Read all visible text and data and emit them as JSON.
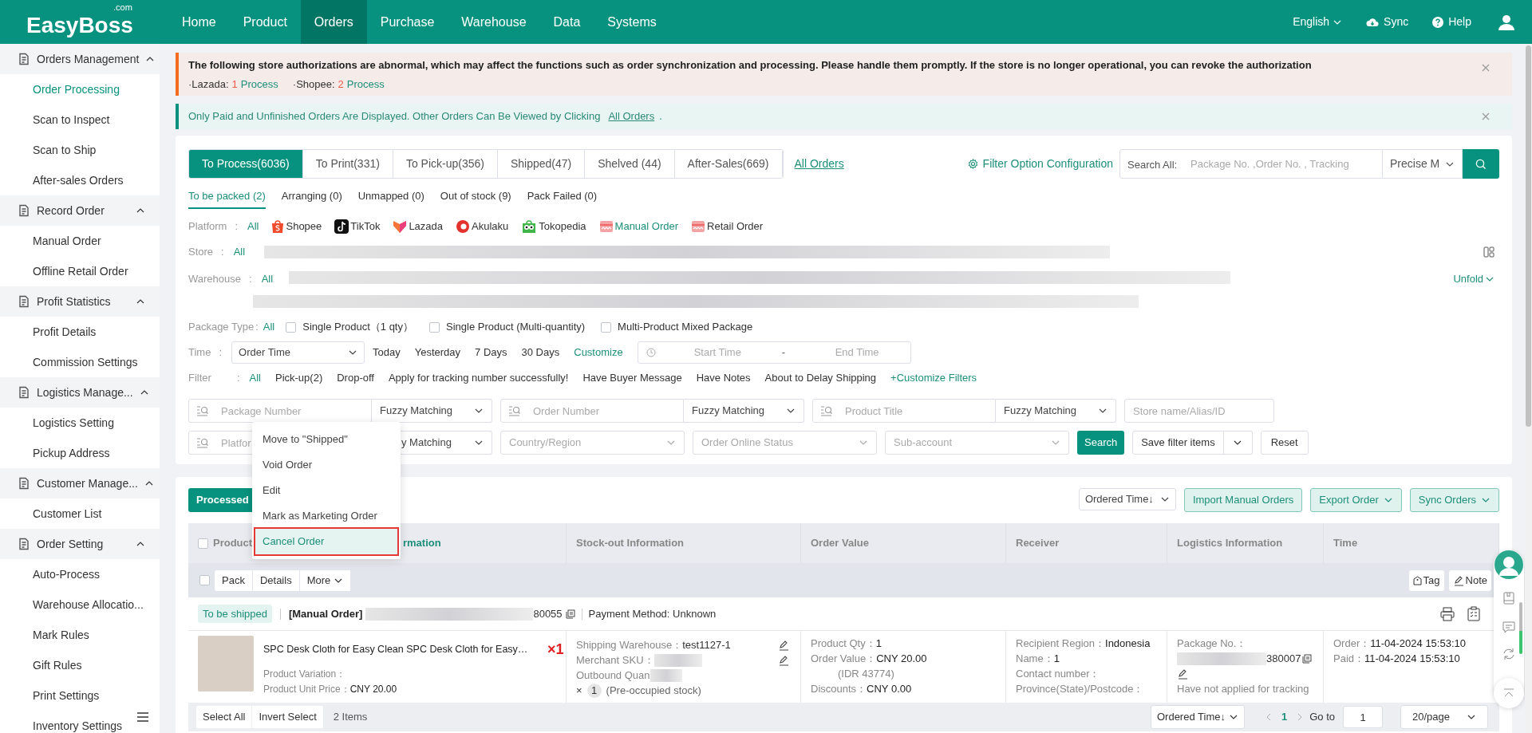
{
  "header": {
    "logo": "EasyBoss",
    "logo_suffix": ".com",
    "nav": [
      {
        "label": "Home",
        "selected": false
      },
      {
        "label": "Product",
        "selected": false
      },
      {
        "label": "Orders",
        "selected": true
      },
      {
        "label": "Purchase",
        "selected": false
      },
      {
        "label": "Warehouse",
        "selected": false
      },
      {
        "label": "Data",
        "selected": false
      },
      {
        "label": "Systems",
        "selected": false
      }
    ],
    "language": "English",
    "sync": "Sync",
    "help": "Help"
  },
  "sidebar": {
    "groups": [
      {
        "label": "Orders Management",
        "expanded": true,
        "items": [
          {
            "label": "Order Processing",
            "selected": true
          },
          {
            "label": "Scan to Inspect",
            "selected": false
          },
          {
            "label": "Scan to Ship",
            "selected": false
          },
          {
            "label": "After-sales Orders",
            "selected": false
          }
        ]
      },
      {
        "label": "Record Order",
        "expanded": true,
        "items": [
          {
            "label": "Manual Order",
            "selected": false
          },
          {
            "label": "Offline Retail Order",
            "selected": false
          }
        ]
      },
      {
        "label": "Profit Statistics",
        "expanded": true,
        "items": [
          {
            "label": "Profit Details",
            "selected": false
          },
          {
            "label": "Commission Settings",
            "selected": false
          }
        ]
      },
      {
        "label": "Logistics Manage...",
        "expanded": true,
        "items": [
          {
            "label": "Logistics Setting",
            "selected": false
          },
          {
            "label": "Pickup Address",
            "selected": false
          }
        ]
      },
      {
        "label": "Customer Manage...",
        "expanded": true,
        "items": [
          {
            "label": "Customer List",
            "selected": false
          }
        ]
      },
      {
        "label": "Order Setting",
        "expanded": true,
        "items": [
          {
            "label": "Auto-Process",
            "selected": false
          },
          {
            "label": "Warehouse Allocatio...",
            "selected": false
          },
          {
            "label": "Mark Rules",
            "selected": false
          },
          {
            "label": "Gift Rules",
            "selected": false
          },
          {
            "label": "Print Settings",
            "selected": false
          },
          {
            "label": "Inventory Settings",
            "selected": false
          }
        ]
      }
    ]
  },
  "warning_alert": {
    "text": "The following store authorizations are abnormal, which may affect the functions such as order synchronization and processing. Please handle them promptly. If the store is no longer operational, you can revoke the authorization",
    "stores": [
      {
        "label": "·Lazada:",
        "count": "1",
        "action": "Process"
      },
      {
        "label": "·Shopee:",
        "count": "2",
        "action": "Process"
      }
    ]
  },
  "info_alert": {
    "text": "Only Paid and Unfinished Orders Are Displayed. Other Orders Can Be Viewed by Clicking",
    "link": "All Orders",
    "tail": "."
  },
  "filters": {
    "tabs": [
      {
        "label": "To Process(6036)",
        "selected": true
      },
      {
        "label": "To Print(331)",
        "selected": false
      },
      {
        "label": "To Pick-up(356)",
        "selected": false
      },
      {
        "label": "Shipped(47)",
        "selected": false
      },
      {
        "label": "Shelved (44)",
        "selected": false
      },
      {
        "label": "After-Sales(669)",
        "selected": false
      }
    ],
    "all_orders": "All Orders",
    "config": "Filter Option Configuration",
    "search_label": "Search All:",
    "search_placeholder": "Package No. ,Order No. , Tracking",
    "match_mode": "Precise M",
    "subtabs": [
      {
        "label": "To be packed (2)",
        "selected": true
      },
      {
        "label": "Arranging (0)",
        "selected": false
      },
      {
        "label": "Unmapped (0)",
        "selected": false
      },
      {
        "label": "Out of stock (9)",
        "selected": false
      },
      {
        "label": "Pack Failed (0)",
        "selected": false
      }
    ],
    "platform": {
      "label": "Platform",
      "colon": ":",
      "options": [
        {
          "label": "All",
          "kind": "text",
          "selected": true
        },
        {
          "label": "Shopee",
          "kind": "platform",
          "selected": false
        },
        {
          "label": "TikTok",
          "kind": "platform",
          "selected": false
        },
        {
          "label": "Lazada",
          "kind": "platform",
          "selected": false
        },
        {
          "label": "Akulaku",
          "kind": "platform",
          "selected": false
        },
        {
          "label": "Tokopedia",
          "kind": "platform",
          "selected": false
        },
        {
          "label": "Manual Order",
          "kind": "platform",
          "selected": true
        },
        {
          "label": "Retail Order",
          "kind": "platform",
          "selected": false
        }
      ]
    },
    "store": {
      "label": "Store",
      "colon": ":",
      "all": "All"
    },
    "warehouse": {
      "label": "Warehouse",
      "colon": ":",
      "all": "All",
      "unfold": "Unfold"
    },
    "package_type": {
      "label": "Package Type",
      "colon": ":",
      "all": "All",
      "options": [
        {
          "label": "Single Product（1 qty）",
          "checked": false
        },
        {
          "label": "Single Product (Multi-quantity)",
          "checked": false
        },
        {
          "label": "Multi-Product Mixed Package",
          "checked": false
        }
      ]
    },
    "time": {
      "label": "Time",
      "colon": ":",
      "field": "Order Time",
      "options": [
        {
          "label": "Today",
          "selected": false
        },
        {
          "label": "Yesterday",
          "selected": false
        },
        {
          "label": "7 Days",
          "selected": false
        },
        {
          "label": "30 Days",
          "selected": false
        },
        {
          "label": "Customize",
          "selected": true
        }
      ],
      "start_placeholder": "Start Time",
      "separator": "-",
      "end_placeholder": "End Time"
    },
    "filter": {
      "label": "Filter",
      "colon": ":",
      "options": [
        {
          "label": "All",
          "selected": true
        },
        {
          "label": "Pick-up(2)",
          "selected": false
        },
        {
          "label": "Drop-off",
          "selected": false
        },
        {
          "label": "Apply for tracking number successfully!",
          "selected": false
        },
        {
          "label": "Have Buyer Message",
          "selected": false
        },
        {
          "label": "Have Notes",
          "selected": false
        },
        {
          "label": "About to Delay Shipping",
          "selected": false
        }
      ],
      "customize": "+Customize Filters"
    },
    "row1": [
      {
        "placeholder": "Package Number",
        "match": "Fuzzy Matching"
      },
      {
        "placeholder": "Order Number",
        "match": "Fuzzy Matching"
      },
      {
        "placeholder": "Product Title",
        "match": "Fuzzy Matching"
      }
    ],
    "store_placeholder": "Store name/Alias/ID",
    "row2_first": {
      "placeholder": "Platfor",
      "match": "y Matching"
    },
    "row2_selects": [
      "Country/Region",
      "Order Online Status",
      "Sub-account"
    ],
    "search_button": "Search",
    "save_filter": "Save filter items",
    "reset": "Reset"
  },
  "menu": {
    "items": [
      {
        "label": "Move to \"Shipped\"",
        "selected": false,
        "outlined": false
      },
      {
        "label": "Void Order",
        "selected": false,
        "outlined": false
      },
      {
        "label": "Edit",
        "selected": false,
        "outlined": false
      },
      {
        "label": "Mark as Marketing Order",
        "selected": false,
        "outlined": false
      },
      {
        "label": "Cancel Order",
        "selected": true,
        "outlined": true
      }
    ]
  },
  "orders": {
    "processed": "Processed",
    "sort": "Ordered Time↓",
    "actions": [
      {
        "label": "Import Manual Orders",
        "has_menu": false
      },
      {
        "label": "Export Order",
        "has_menu": true
      },
      {
        "label": "Sync Orders",
        "has_menu": true
      }
    ],
    "select_all_checked": false,
    "columns": [
      {
        "label": "Product",
        "active": false
      },
      {
        "label": "rmation",
        "active": true
      },
      {
        "label": "Stock-out Information",
        "active": false
      },
      {
        "label": "Order Value",
        "active": false
      },
      {
        "label": "Receiver",
        "active": false
      },
      {
        "label": "Logistics Information",
        "active": false
      },
      {
        "label": "Time",
        "active": false
      }
    ],
    "row_checked": false,
    "row_buttons": [
      {
        "label": "Pack",
        "has_menu": false
      },
      {
        "label": "Details",
        "has_menu": false
      },
      {
        "label": "More",
        "has_menu": true
      }
    ],
    "tag": "Tag",
    "note": "Note",
    "order": {
      "status": "To be shipped",
      "source": "[Manual Order]",
      "number_tail": "80055",
      "payment": "Payment Method: Unknown",
      "title": "SPC Desk Cloth for Easy Clean SPC Desk Cloth for Easy…",
      "quantity": "×1",
      "product_fields": [
        {
          "label": "Product Variation："
        },
        {
          "label": "Product Unit Price：",
          "value": "CNY 20.00"
        }
      ],
      "warehouse_label": "Shipping Warehouse：",
      "warehouse": "test1127-1",
      "sku_label": "Merchant SKU：",
      "outbound_label": "Outbound Quan",
      "times": "×",
      "stock_qty": "1",
      "stock_note": "(Pre-occupied stock)",
      "value_fields": [
        {
          "label": "Product Qty：",
          "value": "1"
        },
        {
          "label": "Order Value：",
          "value": "CNY 20.00"
        },
        {
          "note": "(IDR 43774)"
        },
        {
          "label": "Discounts：",
          "value": "CNY 0.00"
        }
      ],
      "receiver_fields": [
        {
          "label": "Recipient Region：",
          "value": "Indonesia"
        },
        {
          "label": "Name：",
          "value": "1"
        },
        {
          "label": "Contact number："
        },
        {
          "label": "Province(State)/Postcode："
        }
      ],
      "package_label": "Package No.：",
      "package_tail": "380007",
      "tracking_note": "Have not applied for tracking",
      "time_fields": [
        {
          "label": "Order：",
          "value": "11-04-2024 15:53:10"
        },
        {
          "label": "Paid：",
          "value": "11-04-2024 15:53:10"
        }
      ]
    },
    "footer": {
      "buttons": [
        "Select All",
        "Invert Select"
      ],
      "count": "2 Items",
      "sort": "Ordered Time↓",
      "pages": [
        {
          "label": "1",
          "selected": true
        }
      ],
      "goto": "Go to",
      "goto_value": "1",
      "page_size": "20/page"
    }
  }
}
